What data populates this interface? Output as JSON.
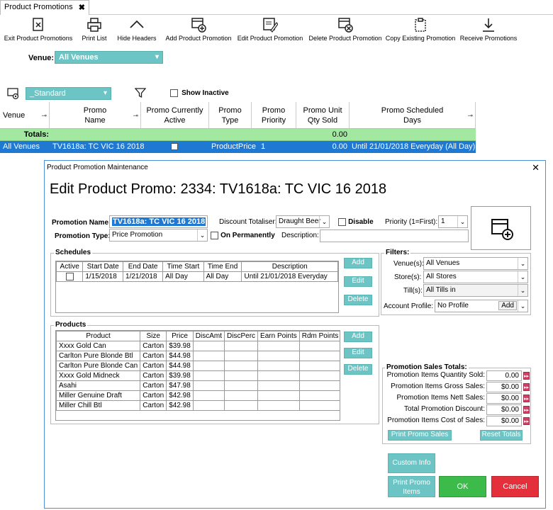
{
  "tab": {
    "title": "Product Promotions",
    "close": "✖"
  },
  "toolbar": [
    {
      "label": "Exit Product Promotions"
    },
    {
      "label": "Print List"
    },
    {
      "label": "Hide Headers"
    },
    {
      "label": "Add Product Promotion"
    },
    {
      "label": "Edit Product Promotion"
    },
    {
      "label": "Delete Product Promotion"
    },
    {
      "label": "Copy Existing Promotion"
    },
    {
      "label": "Receive Promotions"
    }
  ],
  "venue": {
    "label": "Venue:",
    "value": "All Venues"
  },
  "layout": {
    "value": "_Standard"
  },
  "show_inactive": {
    "label": "Show Inactive"
  },
  "grid": {
    "headers": [
      "Venue",
      "Promo Name",
      "Promo Currently Active",
      "Promo Type",
      "Promo Priority",
      "Promo Unit Qty Sold",
      "Promo Scheduled Days"
    ],
    "totals_label": "Totals:",
    "totals_qty": "0.00",
    "row": {
      "venue": "All Venues",
      "name": "TV1618a: TC VIC 16 2018",
      "type": "ProductPrice",
      "priority": "1",
      "qty": "0.00",
      "days": "Until 21/01/2018 Everyday (All Day)"
    }
  },
  "dialog": {
    "title": "Product Promotion Maintenance",
    "close": "✕",
    "heading": "Edit Product Promo: 2334: TV1618a: TC VIC 16 2018",
    "promo_name_label": "Promotion Name:",
    "promo_name": "TV1618a: TC VIC 16 2018",
    "discount_totaliser_label": "Discount Totaliser:",
    "discount_totaliser": "Draught Beer",
    "disable_label": "Disable",
    "priority_label": "Priority (1=First):",
    "priority": "1",
    "promo_type_label": "Promotion Type:",
    "promo_type": "Price Promotion",
    "on_perm_label": "On Permanently",
    "description_label": "Description:",
    "description": "",
    "schedules": {
      "title": "Schedules",
      "headers": [
        "Active",
        "Start Date",
        "End Date",
        "Time Start",
        "Time End",
        "Description"
      ],
      "rows": [
        [
          "",
          "1/15/2018",
          "1/21/2018",
          "All Day",
          "All Day",
          "Until 21/01/2018 Everyday"
        ]
      ],
      "add": "Add",
      "edit": "Edit",
      "delete": "Delete"
    },
    "filters": {
      "title": "Filters:",
      "venue_label": "Venue(s):",
      "venue": "All Venues",
      "store_label": "Store(s):",
      "store": "All Stores",
      "till_label": "Till(s):",
      "till": "All Tills in",
      "account_label": "Account Profile:",
      "account": "No Profile",
      "account_add": "Add"
    },
    "products": {
      "title": "Products",
      "headers": [
        "Product",
        "Size",
        "Price",
        "DiscAmt",
        "DiscPerc",
        "Earn Points",
        "Rdm Points"
      ],
      "rows": [
        [
          "Xxxx Gold Can",
          "Carton",
          "$39.98"
        ],
        [
          "Carlton Pure Blonde Btl",
          "Carton",
          "$44.98"
        ],
        [
          "Carlton Pure Blonde Can",
          "Carton",
          "$44.98"
        ],
        [
          "Xxxx Gold Midneck",
          "Carton",
          "$39.98"
        ],
        [
          "Asahi",
          "Carton",
          "$47.98"
        ],
        [
          "Miller Genuine Draft",
          "Carton",
          "$42.98"
        ],
        [
          "Miller Chill Btl",
          "Carton",
          "$42.98"
        ]
      ],
      "add": "Add",
      "edit": "Edit",
      "delete": "Delete"
    },
    "totals": {
      "title": "Promotion Sales Totals:",
      "rows": [
        {
          "label": "Promotion Items Quantity Sold:",
          "value": "0.00"
        },
        {
          "label": "Promotion Items Gross Sales:",
          "value": "$0.00"
        },
        {
          "label": "Promotion Items Nett Sales:",
          "value": "$0.00"
        },
        {
          "label": "Total Promotion Discount:",
          "value": "$0.00"
        },
        {
          "label": "Promotion Items Cost of Sales:",
          "value": "$0.00"
        }
      ],
      "print": "Print Promo Sales",
      "reset": "Reset Totals"
    },
    "custom_info": "Custom Info",
    "print_items": "Print Promo Items",
    "ok": "OK",
    "cancel": "Cancel"
  }
}
